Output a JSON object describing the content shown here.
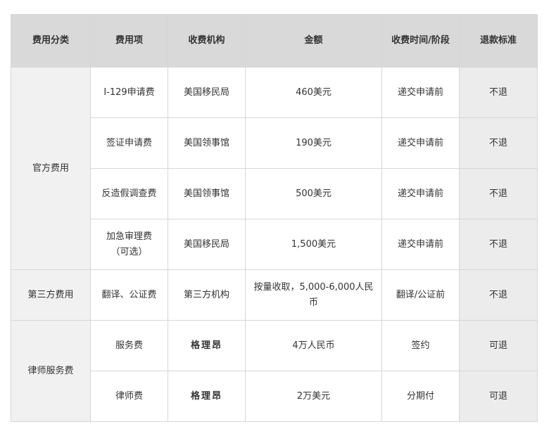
{
  "headers": [
    "费用分类",
    "费用项",
    "收费机构",
    "金额",
    "收费时间/阶段",
    "退款标准"
  ],
  "groups": [
    {
      "category": "官方费用",
      "rows": [
        {
          "item": "I-129申请费",
          "org": "美国移民局",
          "amount": "460美元",
          "time": "递交申请前",
          "refund": "不退"
        },
        {
          "item": "签证申请费",
          "org": "美国领事馆",
          "amount": "190美元",
          "time": "递交申请前",
          "refund": "不退"
        },
        {
          "item": "反造假调查费",
          "org": "美国领事馆",
          "amount": "500美元",
          "time": "递交申请前",
          "refund": "不退"
        },
        {
          "item": "加急审理费（可选）",
          "org": "美国移民局",
          "amount": "1,500美元",
          "time": "递交申请前",
          "refund": "不退"
        }
      ]
    },
    {
      "category": "第三方费用",
      "rows": [
        {
          "item": "翻译、公证费",
          "org": "第三方机构",
          "amount": "按量收取，5,000-6,000人民币",
          "time": "翻译/公证前",
          "refund": "不退"
        }
      ]
    },
    {
      "category": "律师服务费",
      "rows": [
        {
          "item": "服务费",
          "org": "格理昂",
          "amount": "4万人民币",
          "time": "签约",
          "refund": "可退"
        },
        {
          "item": "律师费",
          "org": "格理昂",
          "amount": "2万美元",
          "time": "分期付",
          "refund": "可退"
        }
      ]
    }
  ]
}
